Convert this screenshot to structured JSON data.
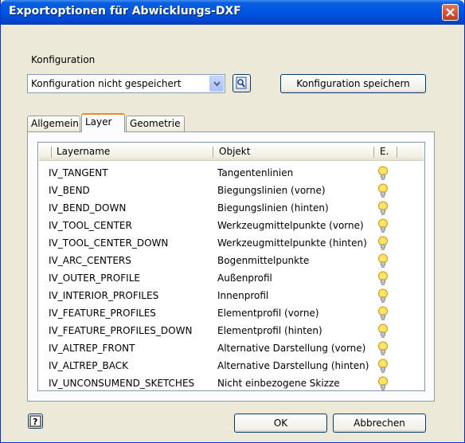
{
  "window": {
    "title": "Exportoptionen für Abwicklungs-DXF"
  },
  "config": {
    "label": "Konfiguration",
    "selected": "Konfiguration nicht gespeichert",
    "save_button": "Konfiguration speichern"
  },
  "tabs": [
    {
      "label": "Allgemein"
    },
    {
      "label": "Layer",
      "active": true
    },
    {
      "label": "Geometrie"
    }
  ],
  "layer_table": {
    "columns": [
      "Layername",
      "Objekt",
      "E."
    ],
    "rows": [
      {
        "name": "IV_TANGENT",
        "object": "Tangentenlinien"
      },
      {
        "name": "IV_BEND",
        "object": "Biegungslinien (vorne)"
      },
      {
        "name": "IV_BEND_DOWN",
        "object": "Biegungslinien (hinten)"
      },
      {
        "name": "IV_TOOL_CENTER",
        "object": "Werkzeugmittelpunkte (vorne)"
      },
      {
        "name": "IV_TOOL_CENTER_DOWN",
        "object": "Werkzeugmittelpunkte (hinten)"
      },
      {
        "name": "IV_ARC_CENTERS",
        "object": "Bogenmittelpunkte"
      },
      {
        "name": "IV_OUTER_PROFILE",
        "object": "Außenprofil"
      },
      {
        "name": "IV_INTERIOR_PROFILES",
        "object": "Innenprofil"
      },
      {
        "name": "IV_FEATURE_PROFILES",
        "object": "Elementprofil (vorne)"
      },
      {
        "name": "IV_FEATURE_PROFILES_DOWN",
        "object": "Elementprofil (hinten)"
      },
      {
        "name": "IV_ALTREP_FRONT",
        "object": "Alternative Darstellung (vorne)"
      },
      {
        "name": "IV_ALTREP_BACK",
        "object": "Alternative Darstellung (hinten)"
      },
      {
        "name": "IV_UNCONSUMEND_SKETCHES",
        "object": "Nicht einbezogene Skizze"
      }
    ],
    "enabled_icon": "lightbulb-icon"
  },
  "footer": {
    "ok": "OK",
    "cancel": "Abbrechen",
    "help_icon": "help-icon"
  },
  "colors": {
    "titlebar": "#0054e3",
    "dialog_bg": "#ece9d8",
    "bulb": "#f5c400",
    "tab_accent": "#e68b2c"
  }
}
